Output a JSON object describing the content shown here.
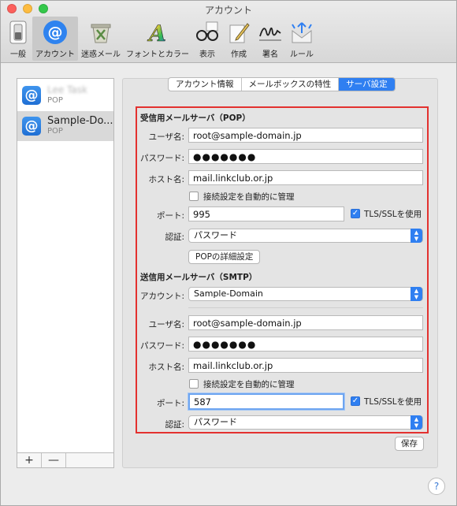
{
  "window": {
    "title": "アカウント"
  },
  "toolbar": {
    "items": [
      {
        "label": "一般",
        "icon": "switch-icon"
      },
      {
        "label": "アカウント",
        "icon": "at-sign-icon"
      },
      {
        "label": "迷惑メール",
        "icon": "junk-mail-icon"
      },
      {
        "label": "フォントとカラー",
        "icon": "font-color-icon"
      },
      {
        "label": "表示",
        "icon": "glasses-icon"
      },
      {
        "label": "作成",
        "icon": "compose-icon"
      },
      {
        "label": "署名",
        "icon": "signature-icon"
      },
      {
        "label": "ルール",
        "icon": "rules-icon"
      }
    ]
  },
  "sidebar": {
    "accounts": [
      {
        "name": "Lee Task",
        "type": "POP"
      },
      {
        "name": "Sample-Do...",
        "type": "POP"
      }
    ],
    "add": "+",
    "remove": "—"
  },
  "tabs": [
    "アカウント情報",
    "メールボックスの特性",
    "サーバ設定"
  ],
  "incoming": {
    "title": "受信用メールサーバ（POP）",
    "username_label": "ユーザ名:",
    "username": "root@sample-domain.jp",
    "password_label": "パスワード:",
    "password": "●●●●●●●",
    "host_label": "ホスト名:",
    "host": "mail.linkclub.or.jp",
    "auto_manage": "接続設定を自動的に管理",
    "port_label": "ポート:",
    "port": "995",
    "tls": "TLS/SSLを使用",
    "auth_label": "認証:",
    "auth": "パスワード",
    "advanced": "POPの詳細設定"
  },
  "outgoing": {
    "title": "送信用メールサーバ（SMTP）",
    "account_label": "アカウント:",
    "account": "Sample-Domain",
    "username_label": "ユーザ名:",
    "username": "root@sample-domain.jp",
    "password_label": "パスワード:",
    "password": "●●●●●●●",
    "host_label": "ホスト名:",
    "host": "mail.linkclub.or.jp",
    "auto_manage": "接続設定を自動的に管理",
    "port_label": "ポート:",
    "port": "587",
    "tls": "TLS/SSLを使用",
    "auth_label": "認証:",
    "auth": "パスワード"
  },
  "save": "保存",
  "help": "?",
  "colors": {
    "accent": "#2f7ff1",
    "highlight_box": "#e3312f"
  }
}
